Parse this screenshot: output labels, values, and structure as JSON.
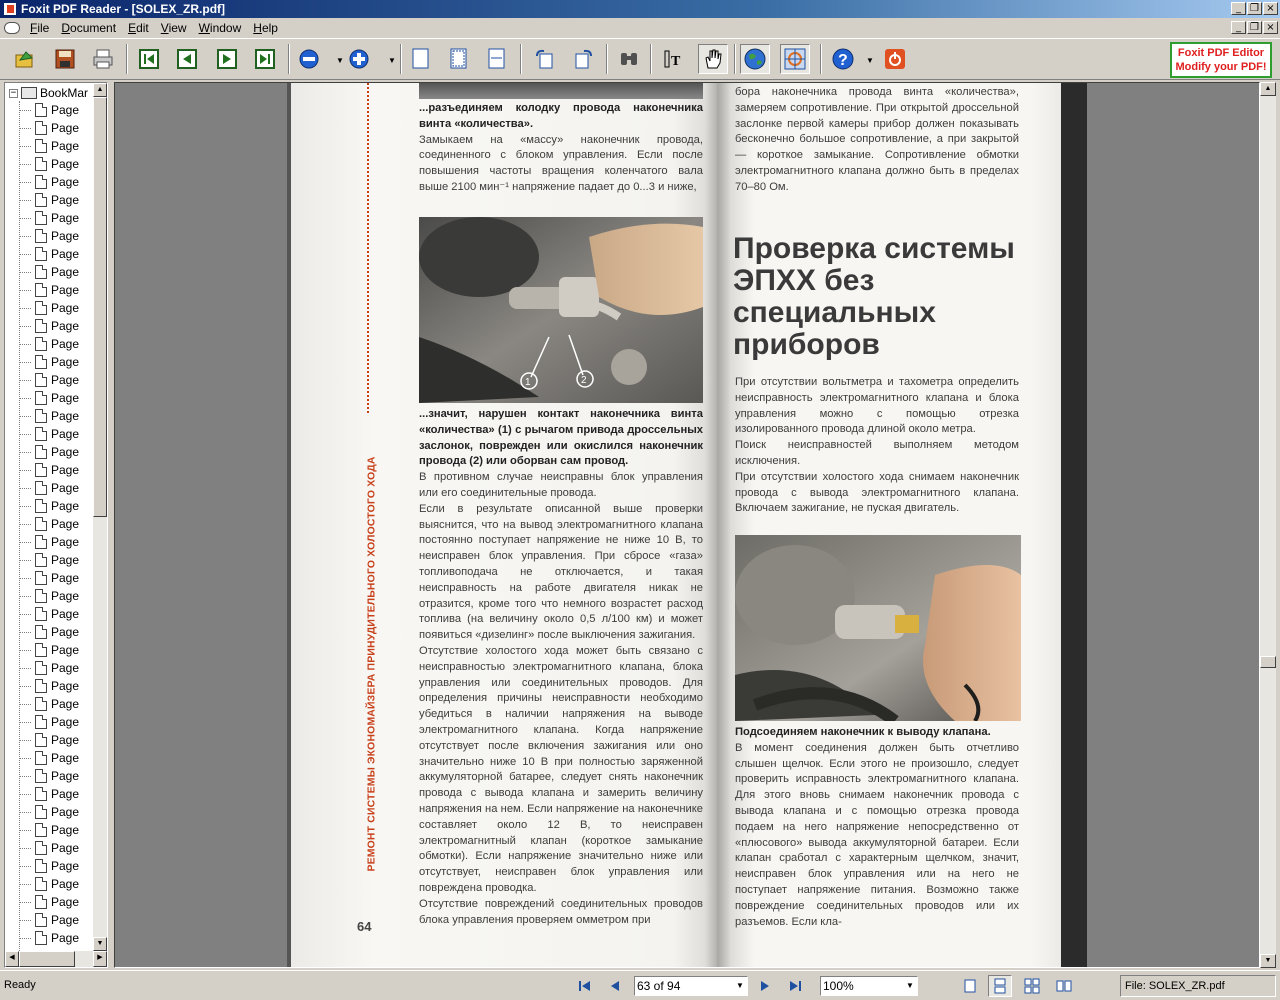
{
  "window": {
    "title": "Foxit PDF Reader - [SOLEX_ZR.pdf]"
  },
  "menu": {
    "items": [
      {
        "key": "F",
        "rest": "ile"
      },
      {
        "key": "D",
        "rest": "ocument"
      },
      {
        "key": "E",
        "rest": "dit"
      },
      {
        "key": "V",
        "rest": "iew"
      },
      {
        "key": "W",
        "rest": "indow"
      },
      {
        "key": "H",
        "rest": "elp"
      }
    ]
  },
  "toolbar": {
    "ad_line1": "Foxit PDF Editor",
    "ad_line2": "Modify your PDF!"
  },
  "bookmarks": {
    "root_label": "BookMar",
    "item_label": "Page",
    "item_count": 47
  },
  "document": {
    "left_top_caption": "...разъединяем колодку провода наконечника винта «количества».",
    "left_para1": "Замыкаем на «массу» наконечник провода, соединенного с блоком управления. Если после повышения частоты вращения коленчатого вала выше 2100 мин⁻¹ напряжение падает до 0...3 и ниже,",
    "photo1_label1": "1",
    "photo1_label2": "2",
    "left_caption2": "...значит, нарушен контакт наконечника винта «количества» (1) с рычагом привода дроссельных заслонок, поврежден или окислился наконечник провода (2) или оборван сам провод.",
    "left_para2": "В противном случае неисправны блок управления или его соединительные провода.",
    "left_para3": "Если в результате описанной выше проверки выяснится, что на вывод электромагнитного клапана постоянно поступает напряжение не ниже 10 В, то неисправен блок управления. При сбросе «газа» топливоподача не отключается, и такая неисправность на работе двигателя никак не отразится, кроме того что немного возрастет расход топлива (на величину около 0,5 л/100 км) и может появиться «дизелинг» после выключения зажигания.",
    "left_para4": "Отсутствие холостого хода может быть связано с неисправностью электромагнитного клапана, блока управления или соединительных проводов. Для определения причины неисправности необходимо убедиться в наличии напряжения на выводе электромагнитного клапана. Когда напряжение отсутствует после включения зажигания или оно значительно ниже 10 В при полностью заряженной аккумуляторной батарее, следует снять наконечник провода с вывода клапана и замерить величину напряжения на нем. Если напряжение на наконечнике составляет около 12 В, то неисправен электромагнитный клапан (короткое замыкание обмотки). Если напряжение значительно ниже или отсутствует, неисправен блок управления или повреждена проводка.",
    "left_para5": "Отсутствие повреждений соединительных проводов блока управления проверяем омметром при",
    "side_title": "РЕМОНТ СИСТЕМЫ ЭКОНОМАЙЗЕРА ПРИНУДИТЕЛЬНОГО ХОЛОСТОГО ХОДА",
    "page_number": "64",
    "right_para1": "бора наконечника провода винта «количества», замеряем сопротивление. При открытой дроссельной заслонке первой камеры прибор должен показывать бесконечно большое сопротивление, а при закрытой — короткое замыкание. Сопротивление обмотки электромагнитного клапана должно быть в пределах 70–80 Ом.",
    "heading": "Проверка системы ЭПХХ без специальных приборов",
    "right_para2": "При отсутствии вольтметра и тахометра определить неисправность электромагнитного клапана и блока управления можно с помощью отрезка изолированного провода длиной около метра.",
    "right_para3": "Поиск неисправностей выполняем методом исключения.",
    "right_para4": "При отсутствии холостого хода снимаем наконечник провода с вывода электромагнитного клапана. Включаем зажигание, не пуская двигатель.",
    "right_caption": "Подсоединяем наконечник к выводу клапана.",
    "right_para5": "В момент соединения должен быть отчетливо слышен щелчок. Если этого не произошло, следует проверить исправность электромагнитного клапана. Для этого вновь снимаем наконечник провода с вывода клапана и с помощью отрезка провода подаем на него напряжение непосредственно от «плюсового» вывода аккумуляторной батареи. Если клапан сработал с характерным щелчком, значит, неисправен блок управления или на него не поступает напряжение питания. Возможно также повреждение соединительных проводов или их разъемов. Если кла-"
  },
  "status": {
    "ready": "Ready",
    "page_field": "63 of 94",
    "zoom": "100%",
    "file": "File: SOLEX_ZR.pdf"
  },
  "colors": {
    "titlebar": "#0a246a",
    "side_title": "#c8401a",
    "ad_border": "#2e9e2e",
    "ad_text": "#e02020"
  }
}
